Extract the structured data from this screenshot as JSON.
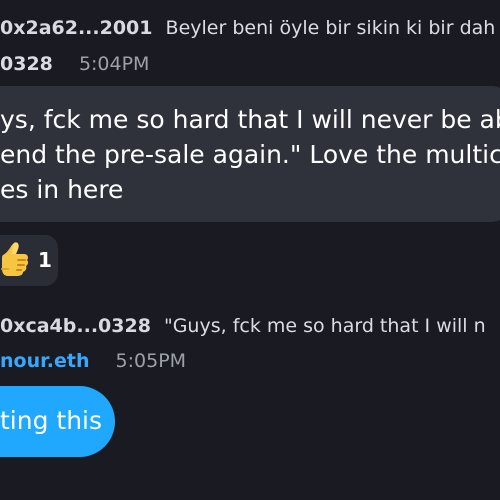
{
  "messages": {
    "reply_1": {
      "sender": "0x2a62...2001",
      "text": "Beyler beni öyle bir sikin ki bir dah"
    },
    "message_1": {
      "author": "0328",
      "time": "5:04PM",
      "lines": [
        "ys, fck me so hard that I will never be able",
        "end the pre-sale again.\" Love the multicult",
        "es in here"
      ],
      "reaction": {
        "emoji": "thumbs-up-icon",
        "count": "1"
      }
    },
    "reply_2": {
      "sender": "0xca4b...0328",
      "text": "\"Guys, fck me so hard that I will n"
    },
    "message_2": {
      "author": "nour.eth",
      "time": "5:05PM",
      "text": "ting this"
    }
  },
  "colors": {
    "background": "#1a1b22",
    "message_bubble": "#2f313b",
    "reaction_pill": "#2b2d36",
    "outgoing_bubble": "#20a8ff",
    "username_accent": "#38a8ff",
    "timestamp": "#9ca0aa"
  }
}
